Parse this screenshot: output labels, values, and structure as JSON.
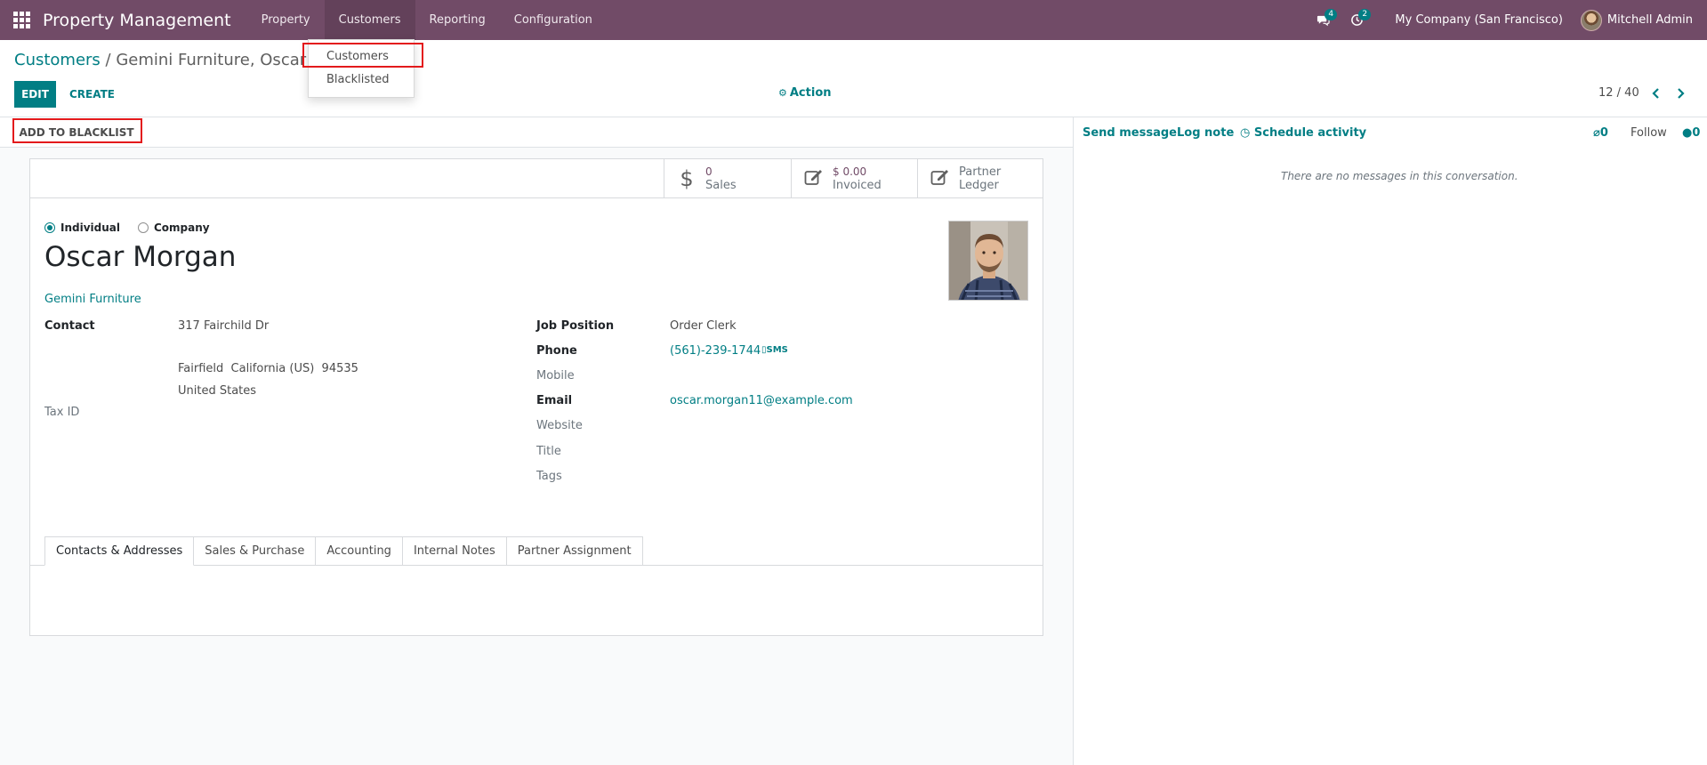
{
  "navbar": {
    "brand": "Property Management",
    "menus": [
      {
        "label": "Property"
      },
      {
        "label": "Customers"
      },
      {
        "label": "Reporting"
      },
      {
        "label": "Configuration"
      }
    ],
    "messages_count": "4",
    "activities_count": "2",
    "company": "My Company (San Francisco)",
    "user": "Mitchell Admin"
  },
  "dropdown": {
    "items": [
      {
        "label": "Customers"
      },
      {
        "label": "Blacklisted"
      }
    ]
  },
  "control_panel": {
    "breadcrumb_parent": "Customers",
    "breadcrumb_current": " / Gemini Furniture, Oscar Mor",
    "edit_label": "EDIT",
    "create_label": "CREATE",
    "action_label": "Action",
    "pager": "12 / 40"
  },
  "statusbar": {
    "blacklist_label": "ADD TO BLACKLIST"
  },
  "stat_buttons": {
    "sales_value": "0",
    "sales_label": "Sales",
    "invoiced_value": "$ 0.00",
    "invoiced_label": "Invoiced",
    "ledger_label": "Partner Ledger"
  },
  "form": {
    "type_individual": "Individual",
    "type_company": "Company",
    "name": "Oscar Morgan",
    "parent": "Gemini Furniture",
    "contact_label": "Contact",
    "street": "317 Fairchild Dr",
    "city_line": "Fairfield  California (US)  94535",
    "country": "United States",
    "tax_id_label": "Tax ID",
    "job_position_label": "Job Position",
    "job_position": "Order Clerk",
    "phone_label": "Phone",
    "phone": "(561)-239-1744",
    "sms_label": "SMS",
    "mobile_label": "Mobile",
    "email_label": "Email",
    "email": "oscar.morgan11@example.com",
    "website_label": "Website",
    "title_label": "Title",
    "tags_label": "Tags"
  },
  "tabs": [
    {
      "label": "Contacts & Addresses"
    },
    {
      "label": "Sales & Purchase"
    },
    {
      "label": "Accounting"
    },
    {
      "label": "Internal Notes"
    },
    {
      "label": "Partner Assignment"
    }
  ],
  "chatter": {
    "send_message": "Send message",
    "log_note": "Log note",
    "schedule_activity": "Schedule activity",
    "attachments_count": "0",
    "follow_label": "Follow",
    "followers_count": "0",
    "empty_text": "There are no messages in this conversation."
  },
  "colors": {
    "navbar": "#714b67",
    "accent": "#017e84",
    "highlight": "#e31a1c"
  }
}
